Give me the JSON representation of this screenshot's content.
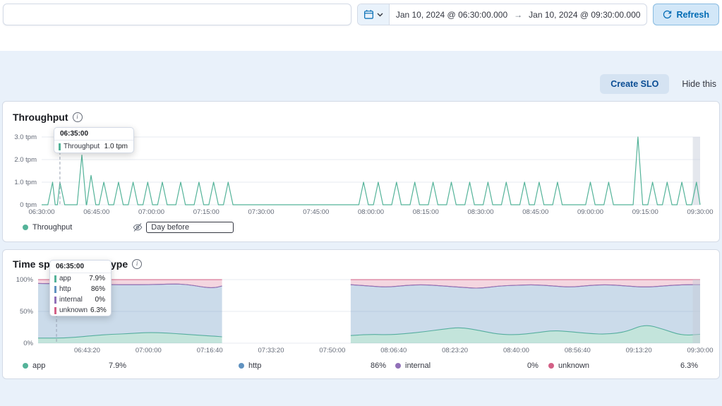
{
  "icons": {
    "info": "i"
  },
  "topbar": {
    "query": {
      "value": ""
    },
    "date_start": "Jan 10, 2024 @ 06:30:00.000",
    "date_range_arrow": "→",
    "date_end": "Jan 10, 2024 @ 09:30:00.000",
    "refresh_label": "Refresh"
  },
  "actions": {
    "create_slo_label": "Create SLO",
    "hide_this_label": "Hide this"
  },
  "throughput": {
    "title": "Throughput",
    "tooltip": {
      "header": "06:35:00",
      "series_label": "Throughput",
      "value": "1.0 tpm"
    },
    "legend_series_label": "Throughput",
    "legend_comparison_label": "Day before"
  },
  "span_types": {
    "title": "Time spent by span type",
    "tooltip_header": "06:35:00",
    "legend": [
      {
        "label": "app",
        "value": "7.9%",
        "color": "#54B399"
      },
      {
        "label": "http",
        "value": "86%",
        "color": "#6092C0"
      },
      {
        "label": "internal",
        "value": "0%",
        "color": "#9170B8"
      },
      {
        "label": "unknown",
        "value": "6.3%",
        "color": "#D36086"
      }
    ]
  },
  "chart_data": [
    {
      "type": "line",
      "title": "Throughput",
      "ylabel": "tpm",
      "color": "#54B399",
      "x_range_minutes_after_0630": [
        0,
        180
      ],
      "ylim": [
        0,
        3.2
      ],
      "y_ticks": [
        {
          "label": "3.0 tpm",
          "v": 3
        },
        {
          "label": "2.0 tpm",
          "v": 2
        },
        {
          "label": "1.0 tpm",
          "v": 1
        },
        {
          "label": "0 tpm",
          "v": 0
        }
      ],
      "x_ticks": [
        {
          "label": "06:30:00",
          "t": 0
        },
        {
          "label": "06:45:00",
          "t": 15
        },
        {
          "label": "07:00:00",
          "t": 30
        },
        {
          "label": "07:15:00",
          "t": 45
        },
        {
          "label": "07:30:00",
          "t": 60
        },
        {
          "label": "07:45:00",
          "t": 75
        },
        {
          "label": "08:00:00",
          "t": 90
        },
        {
          "label": "08:15:00",
          "t": 105
        },
        {
          "label": "08:30:00",
          "t": 120
        },
        {
          "label": "08:45:00",
          "t": 135
        },
        {
          "label": "09:00:00",
          "t": 150
        },
        {
          "label": "09:15:00",
          "t": 165
        },
        {
          "label": "09:30:00",
          "t": 180
        }
      ],
      "baseline_tpm": 0,
      "spikes_t_min_tpm": [
        [
          3,
          1
        ],
        [
          5,
          1
        ],
        [
          11,
          2.2
        ],
        [
          13.5,
          1.3
        ],
        [
          17,
          1
        ],
        [
          21,
          1
        ],
        [
          25,
          1
        ],
        [
          29,
          1
        ],
        [
          33,
          1
        ],
        [
          38,
          1
        ],
        [
          43,
          1
        ],
        [
          47,
          1
        ],
        [
          51,
          1
        ],
        [
          88,
          1
        ],
        [
          92,
          1
        ],
        [
          97,
          1
        ],
        [
          102,
          1
        ],
        [
          107,
          1
        ],
        [
          112,
          1
        ],
        [
          117,
          1
        ],
        [
          122,
          1
        ],
        [
          127,
          1
        ],
        [
          132,
          1
        ],
        [
          136,
          1
        ],
        [
          141,
          1
        ],
        [
          150,
          1
        ],
        [
          155,
          1
        ],
        [
          163,
          3
        ],
        [
          167,
          1
        ],
        [
          171,
          1
        ],
        [
          175,
          1
        ],
        [
          179,
          1
        ]
      ],
      "cursor_t": 5,
      "partial_bucket_t": [
        178,
        180
      ]
    },
    {
      "type": "area",
      "stacked_percent": true,
      "title": "Time spent by span type",
      "ylim": [
        0,
        100
      ],
      "y_ticks": [
        {
          "label": "100%",
          "v": 100
        },
        {
          "label": "50%",
          "v": 50
        },
        {
          "label": "0%",
          "v": 0
        }
      ],
      "x_ticks": [
        {
          "label": "06:43:20",
          "t": 13.33
        },
        {
          "label": "07:00:00",
          "t": 30
        },
        {
          "label": "07:16:40",
          "t": 46.67
        },
        {
          "label": "07:33:20",
          "t": 63.33
        },
        {
          "label": "07:50:00",
          "t": 80
        },
        {
          "label": "08:06:40",
          "t": 96.67
        },
        {
          "label": "08:23:20",
          "t": 113.33
        },
        {
          "label": "08:40:00",
          "t": 130
        },
        {
          "label": "08:56:40",
          "t": 146.67
        },
        {
          "label": "09:13:20",
          "t": 163.33
        },
        {
          "label": "09:30:00",
          "t": 180
        }
      ],
      "series_order": [
        "app",
        "http",
        "internal",
        "unknown"
      ],
      "colors": {
        "app": "#54B399",
        "http": "#6092C0",
        "internal": "#9170B8",
        "unknown": "#D36086"
      },
      "fills": {
        "app": "rgba(84,179,153,0.35)",
        "http": "rgba(96,146,192,0.33)",
        "internal": "rgba(145,112,184,0.30)",
        "unknown": "rgba(211,96,134,0.26)"
      },
      "regions": [
        {
          "t": [
            0,
            5,
            10,
            15,
            20,
            25,
            30,
            35,
            40,
            45,
            48,
            50
          ],
          "app": [
            8,
            7.9,
            9,
            12,
            14,
            15,
            17,
            16,
            14,
            12,
            11,
            10
          ],
          "http": [
            86,
            85.8,
            84,
            81,
            78,
            77,
            75,
            77,
            79,
            76,
            76,
            80
          ],
          "internal": [
            0,
            0,
            0,
            0,
            0,
            0,
            0,
            0,
            0,
            0,
            0,
            0
          ],
          "unknown": [
            6,
            6.3,
            7,
            7,
            8,
            8,
            8,
            7,
            7,
            12,
            13,
            10
          ]
        },
        {
          "t": [
            85,
            90,
            95,
            100,
            105,
            110,
            115,
            120,
            125,
            130,
            135,
            140,
            145,
            150,
            155,
            160,
            165,
            170,
            175,
            180
          ],
          "app": [
            12,
            14,
            13,
            15,
            18,
            22,
            25,
            20,
            14,
            13,
            16,
            20,
            18,
            15,
            14,
            18,
            30,
            22,
            12,
            14
          ],
          "http": [
            80,
            76,
            75,
            76,
            74,
            68,
            63,
            66,
            76,
            78,
            76,
            70,
            70,
            76,
            78,
            72,
            58,
            68,
            80,
            78
          ],
          "internal": [
            0,
            0,
            0,
            0,
            0,
            0,
            0,
            0,
            0,
            0,
            0,
            0,
            0,
            0,
            0,
            0,
            0,
            0,
            0,
            0
          ],
          "unknown": [
            8,
            10,
            12,
            9,
            8,
            10,
            12,
            14,
            10,
            9,
            8,
            10,
            12,
            9,
            8,
            10,
            12,
            10,
            8,
            8
          ]
        }
      ],
      "cursor_t": 5,
      "partial_bucket_t": [
        178,
        180
      ]
    }
  ]
}
